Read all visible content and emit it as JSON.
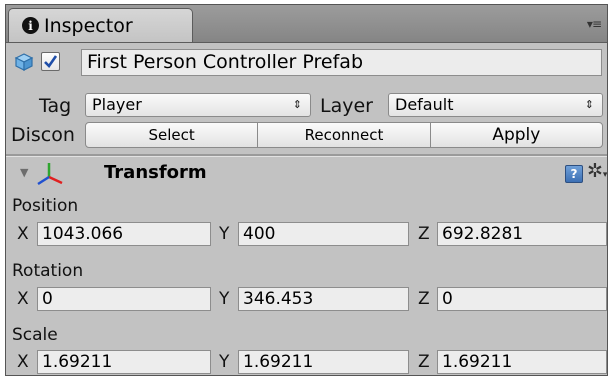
{
  "tab": {
    "label": "Inspector",
    "icon": "info-icon",
    "menu_icon": "▾≡"
  },
  "object": {
    "name": "First Person Controller Prefab",
    "active": true
  },
  "tag": {
    "label": "Tag",
    "value": "Player"
  },
  "layer": {
    "label": "Layer",
    "value": "Default"
  },
  "prefab": {
    "status_label": "Discon",
    "buttons": [
      "Select",
      "Reconnect",
      "Apply"
    ]
  },
  "component": {
    "title": "Transform",
    "help_label": "?",
    "gear_symbol": "✲",
    "gear_caret": "▾",
    "fold_symbol": "▼"
  },
  "position": {
    "label": "Position",
    "x_label": "X",
    "y_label": "Y",
    "z_label": "Z",
    "x": "1043.066",
    "y": "400",
    "z": "692.8281"
  },
  "rotation": {
    "label": "Rotation",
    "x_label": "X",
    "y_label": "Y",
    "z_label": "Z",
    "x": "0",
    "y": "346.453",
    "z": "0"
  },
  "scale": {
    "label": "Scale",
    "x_label": "X",
    "y_label": "Y",
    "z_label": "Z",
    "x": "1.69211",
    "y": "1.69211",
    "z": "1.69211"
  },
  "dropdown_arrow": "⇕",
  "colors": {
    "checkmark": "#1f4ea8",
    "axis_x": "#e02020",
    "axis_y": "#2fa52f",
    "axis_z": "#2050d0",
    "help": "#3c6fb4"
  }
}
